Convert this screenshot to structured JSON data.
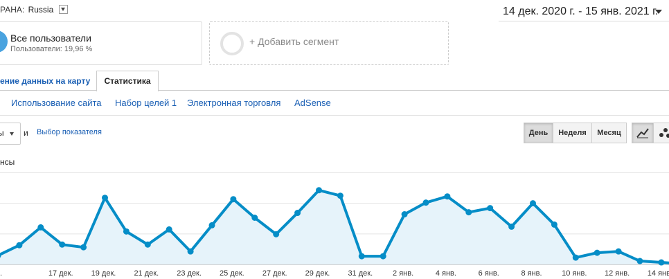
{
  "header": {
    "country_label": "РАНА:",
    "country_value": "Russia",
    "date_range": "14 дек. 2020 г. - 15 янв. 2021 г."
  },
  "segments": {
    "active": {
      "title": "Все пользователи",
      "subtitle": "Пользователи: 19,96 %"
    },
    "add_label": "+ Добавить сегмент"
  },
  "tabs": {
    "map_label": "ение данных на карту",
    "stats_label": "Статистика"
  },
  "subnav": [
    "Использование сайта",
    "Набор целей 1",
    "Электронная торговля",
    "AdSense"
  ],
  "controls": {
    "metric_partial": "ы",
    "and_label": "и",
    "pick_metric": "Выбор показателя",
    "granularity": [
      "День",
      "Неделя",
      "Месяц"
    ],
    "active_granularity": "День",
    "chart_types": [
      "line-chart-icon",
      "motion-chart-icon"
    ]
  },
  "colors": {
    "line": "#058dc7",
    "area": "#e6f3fa",
    "link": "#1a5fb4"
  },
  "chart_data": {
    "type": "area",
    "series_label": "нсы",
    "x_tick_labels": [
      "17 дек.",
      "19 дек.",
      "21 дек.",
      "23 дек.",
      "25 дек.",
      "27 дек.",
      "29 дек.",
      "31 дек.",
      "2 янв.",
      "4 янв.",
      "6 янв.",
      "8 янв.",
      "10 янв.",
      "12 янв.",
      "14 янв."
    ],
    "x": [
      "14 дек.",
      "15 дек.",
      "16 дек.",
      "17 дек.",
      "18 дек.",
      "19 дек.",
      "20 дек.",
      "21 дек.",
      "22 дек.",
      "23 дек.",
      "24 дек.",
      "25 дек.",
      "26 дек.",
      "27 дек.",
      "28 дек.",
      "29 дек.",
      "30 дек.",
      "31 дек.",
      "1 янв.",
      "2 янв.",
      "3 янв.",
      "4 янв.",
      "5 янв.",
      "6 янв.",
      "7 янв.",
      "8 янв.",
      "9 янв.",
      "10 янв.",
      "11 янв.",
      "12 янв.",
      "13 янв.",
      "14 янв.",
      "15 янв."
    ],
    "values": [
      13,
      28,
      54,
      29,
      25,
      97,
      48,
      29,
      51,
      19,
      57,
      95,
      68,
      44,
      75,
      108,
      100,
      12,
      12,
      73,
      90,
      99,
      76,
      82,
      55,
      89,
      58,
      10,
      17,
      19,
      5,
      3,
      1
    ],
    "ylim": [
      0,
      135
    ]
  }
}
